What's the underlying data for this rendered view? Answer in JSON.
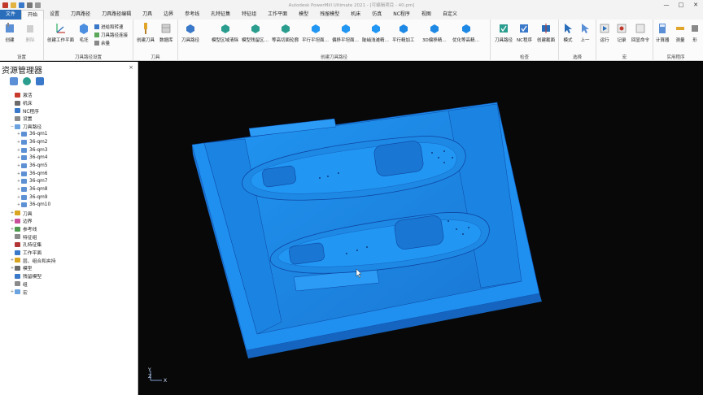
{
  "app": {
    "title": "Autodesk PowerMill Ultimate 2021 - [可编辑项目 - 40.pm]"
  },
  "window_controls": {
    "minimize": "—",
    "maximize": "□",
    "close": "✕"
  },
  "tabs": [
    {
      "label": "文件",
      "kind": "file"
    },
    {
      "label": "开始",
      "kind": "active"
    },
    {
      "label": "设置"
    },
    {
      "label": "刀具路径"
    },
    {
      "label": "刀具路径编辑"
    },
    {
      "label": "刀具"
    },
    {
      "label": "边界"
    },
    {
      "label": "参考线"
    },
    {
      "label": "孔特征集"
    },
    {
      "label": "特征组"
    },
    {
      "label": "工作平面"
    },
    {
      "label": "模型"
    },
    {
      "label": "残留模型"
    },
    {
      "label": "机床"
    },
    {
      "label": "仿真"
    },
    {
      "label": "NC程序"
    },
    {
      "label": "视图"
    },
    {
      "label": "自定义"
    }
  ],
  "ribbon": {
    "groups": {
      "setup": "设置",
      "toolpath_setup": "刀具路径设置",
      "tool": "刀具",
      "create_toolpath": "创建刀具路径",
      "check": "检查",
      "select": "选择",
      "macro": "宏",
      "utility": "实用程序"
    },
    "buttons": {
      "create": "创建",
      "delete": "删除",
      "create_workplane": "创建工作平面",
      "block": "毛坯",
      "lead_link": "进给和转速",
      "connect": "刀具路径连接",
      "feeds": "余量",
      "create_tool": "创建刀具",
      "database": "数据库",
      "toolpath": "刀具路径",
      "model_area_clear": "模型区域清除",
      "model_rest": "模型残留区…",
      "contour_finish": "等高切面轮廓",
      "parallel_flat": "平行平坦面…",
      "offset_flat": "偏移平坦面…",
      "steep_shallow": "陡峭浅滩精…",
      "parallel_finish": "平行精加工",
      "3d_offset": "3D偏移精…",
      "optimized": "优化等高精…",
      "tp_check": "刀具路径",
      "nc_program": "NC程序",
      "create_cross": "创建截面",
      "mode": "模式",
      "prev": "上一",
      "run": "运行",
      "record": "记录",
      "echo": "回显命令",
      "calculator": "计算器",
      "measure": "测量",
      "filter": "形"
    }
  },
  "explorer": {
    "title": "资源管理器",
    "close": "×",
    "items": [
      {
        "label": "激活",
        "depth": 0,
        "exp": "",
        "color": "#c83b2c"
      },
      {
        "label": "机床",
        "depth": 0,
        "exp": "",
        "color": "#6b6b6b"
      },
      {
        "label": "NC程序",
        "depth": 0,
        "exp": "",
        "color": "#3a78c9"
      },
      {
        "label": "设置",
        "depth": 0,
        "exp": "",
        "color": "#8a8a8a"
      },
      {
        "label": "刀具路径",
        "depth": 0,
        "exp": "−",
        "color": "#6aa3e0"
      },
      {
        "label": "36-qm1",
        "depth": 1,
        "exp": "+",
        "color": "#5e90d4"
      },
      {
        "label": "36-qm2",
        "depth": 1,
        "exp": "+",
        "color": "#5e90d4"
      },
      {
        "label": "36-qm3",
        "depth": 1,
        "exp": "+",
        "color": "#5e90d4"
      },
      {
        "label": "36-qm4",
        "depth": 1,
        "exp": "+",
        "color": "#5e90d4"
      },
      {
        "label": "36-qm5",
        "depth": 1,
        "exp": "+",
        "color": "#5e90d4"
      },
      {
        "label": "36-qm6",
        "depth": 1,
        "exp": "+",
        "color": "#5e90d4"
      },
      {
        "label": "36-qm7",
        "depth": 1,
        "exp": "+",
        "color": "#5e90d4"
      },
      {
        "label": "36-qm8",
        "depth": 1,
        "exp": "+",
        "color": "#5e90d4"
      },
      {
        "label": "36-qm9",
        "depth": 1,
        "exp": "+",
        "color": "#5e90d4"
      },
      {
        "label": "36-qm10",
        "depth": 1,
        "exp": "+",
        "color": "#5e90d4"
      },
      {
        "label": "刀具",
        "depth": 0,
        "exp": "+",
        "color": "#d9a520"
      },
      {
        "label": "边界",
        "depth": 0,
        "exp": "+",
        "color": "#c94f9b"
      },
      {
        "label": "参考线",
        "depth": 0,
        "exp": "+",
        "color": "#4f9a4f"
      },
      {
        "label": "特征组",
        "depth": 0,
        "exp": "",
        "color": "#8a8a8a"
      },
      {
        "label": "孔特征集",
        "depth": 0,
        "exp": "",
        "color": "#b23535"
      },
      {
        "label": "工作平面",
        "depth": 0,
        "exp": "",
        "color": "#3a78c9"
      },
      {
        "label": "层、组合和夹持",
        "depth": 0,
        "exp": "+",
        "color": "#d9a520"
      },
      {
        "label": "模型",
        "depth": 0,
        "exp": "+",
        "color": "#6b6b6b"
      },
      {
        "label": "残留模型",
        "depth": 0,
        "exp": "",
        "color": "#3a78c9"
      },
      {
        "label": "组",
        "depth": 0,
        "exp": "",
        "color": "#8a8a8a"
      },
      {
        "label": "宏",
        "depth": 0,
        "exp": "+",
        "color": "#6aa3e0"
      }
    ]
  },
  "viewport": {
    "model_color": "#1e88e5",
    "axis_labels": {
      "y": "Y",
      "z": "Z",
      "x": "X"
    }
  }
}
